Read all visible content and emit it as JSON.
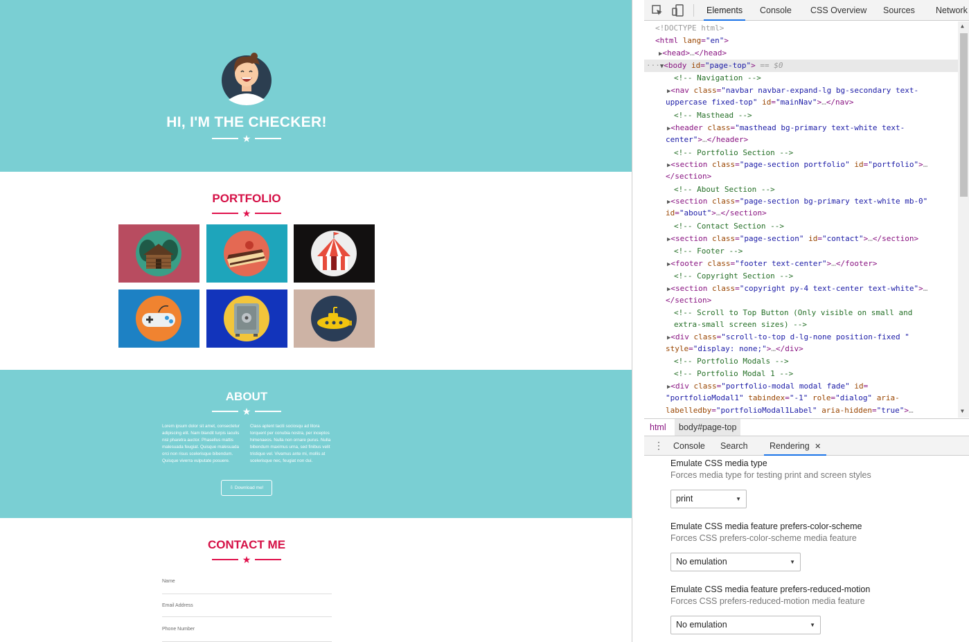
{
  "page": {
    "masthead": {
      "title": "HI, I'M THE CHECKER!",
      "bg": "#7acfd3"
    },
    "portfolio": {
      "title": "PORTFOLIO",
      "tiles": [
        {
          "name": "cabin",
          "bg": "#b84c60",
          "circle": "#3a9e87"
        },
        {
          "name": "cake",
          "bg": "#1ea5bb",
          "circle": "#e46953"
        },
        {
          "name": "circus",
          "bg": "#121010",
          "circle": "#eeeeee"
        },
        {
          "name": "game",
          "bg": "#1d81c4",
          "circle": "#f08330"
        },
        {
          "name": "safe",
          "bg": "#1234bb",
          "circle": "#f2c53b"
        },
        {
          "name": "submarine",
          "bg": "#cdb3a5",
          "circle": "#2a3d56"
        }
      ]
    },
    "about": {
      "title": "ABOUT",
      "left_text": "Lorem ipsum dolor sit amet, consectetur adipiscing elit. Nam blandit turpis iaculis nisl pharetra auctor. Phasellus mattis malesuada feugiat. Quisque malesuada orci non risus scelerisque bibendum. Quisque viverra vulputate posuere.",
      "right_text": "Class aptent taciti sociosqu ad litora torquent per conubia nostra, per inceptos himenaeos. Nulla non ornare purus. Nulla bibendum maximus urna, sed finibus velit tristique vel. Vivamus ante mi, mollis at scelerisque nec, feugiat non dui.",
      "button": "Download me!"
    },
    "contact": {
      "title": "CONTACT ME",
      "fields": [
        "Name",
        "Email Address",
        "Phone Number"
      ]
    }
  },
  "devtools": {
    "tabs": [
      "Elements",
      "Console",
      "CSS Overview",
      "Sources",
      "Network"
    ],
    "active_tab": "Elements",
    "dom": [
      "<!DOCTYPE html>",
      "<html lang=\"en\">",
      "<head>…</head>",
      "<body id=\"page-top\"> == $0",
      "<!-- Navigation -->",
      "<nav class=\"navbar navbar-expand-lg bg-secondary text-uppercase fixed-top\" id=\"mainNav\">…</nav>",
      "<!-- Masthead -->",
      "<header class=\"masthead bg-primary text-white text-center\">…</header>",
      "<!-- Portfolio Section -->",
      "<section class=\"page-section portfolio\" id=\"portfolio\">…</section>",
      "<!-- About Section -->",
      "<section class=\"page-section bg-primary text-white mb-0\" id=\"about\">…</section>",
      "<!-- Contact Section -->",
      "<section class=\"page-section\" id=\"contact\">…</section>",
      "<!-- Footer -->",
      "<footer class=\"footer text-center\">…</footer>",
      "<!-- Copyright Section -->",
      "<section class=\"copyright py-4 text-center text-white\">…</section>",
      "<!-- Scroll to Top Button (Only visible on small and extra-small screen sizes) -->",
      "<div class=\"scroll-to-top d-lg-none position-fixed \" style=\"display: none;\">…</div>",
      "<!-- Portfolio Modals -->",
      "<!-- Portfolio Modal 1 -->",
      "<div class=\"portfolio-modal modal fade\" id=\"portfolioModal1\" tabindex=\"-1\" role=\"dialog\" aria-labelledby=\"portfolioModal1Label\" aria-hidden=\"true\">…"
    ],
    "breadcrumbs": [
      "html",
      "body#page-top"
    ],
    "drawer": {
      "tabs": [
        "Console",
        "Search",
        "Rendering"
      ],
      "active_tab": "Rendering",
      "close": "✕",
      "settings": [
        {
          "title": "Emulate CSS media type",
          "desc": "Forces media type for testing print and screen styles",
          "value": "print"
        },
        {
          "title": "Emulate CSS media feature prefers-color-scheme",
          "desc": "Forces CSS prefers-color-scheme media feature",
          "value": "No emulation"
        },
        {
          "title": "Emulate CSS media feature prefers-reduced-motion",
          "desc": "Forces CSS prefers-reduced-motion media feature",
          "value": "No emulation"
        }
      ]
    }
  }
}
